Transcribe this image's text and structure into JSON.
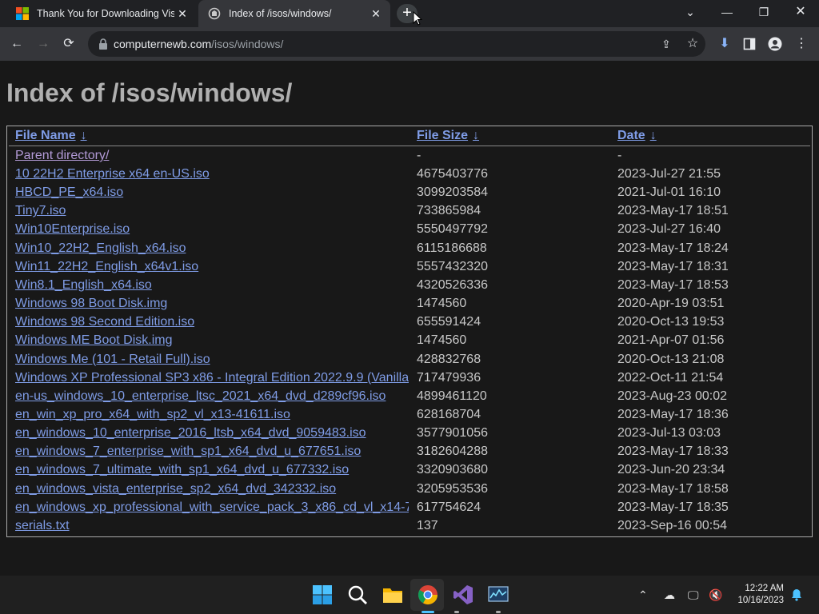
{
  "browser": {
    "tabs": [
      {
        "title": "Thank You for Downloading Visu",
        "active": false
      },
      {
        "title": "Index of /isos/windows/",
        "active": true
      }
    ],
    "new_tab_label": "+",
    "url_domain": "computernewb.com",
    "url_path": "/isos/windows/"
  },
  "page": {
    "heading": "Index of /isos/windows/",
    "columns": {
      "name": "File Name",
      "size": "File Size",
      "date": "Date",
      "sort_arrow": "↓"
    },
    "parent": {
      "name": "Parent directory/",
      "size": "-",
      "date": "-"
    },
    "files": [
      {
        "name": "10 22H2 Enterprise x64 en-US.iso",
        "size": "4675403776",
        "date": "2023-Jul-27 21:55"
      },
      {
        "name": "HBCD_PE_x64.iso",
        "size": "3099203584",
        "date": "2021-Jul-01 16:10"
      },
      {
        "name": "Tiny7.iso",
        "size": "733865984",
        "date": "2023-May-17 18:51"
      },
      {
        "name": "Win10Enterprise.iso",
        "size": "5550497792",
        "date": "2023-Jul-27 16:40"
      },
      {
        "name": "Win10_22H2_English_x64.iso",
        "size": "6115186688",
        "date": "2023-May-17 18:24"
      },
      {
        "name": "Win11_22H2_English_x64v1.iso",
        "size": "5557432320",
        "date": "2023-May-17 18:31"
      },
      {
        "name": "Win8.1_English_x64.iso",
        "size": "4320526336",
        "date": "2023-May-17 18:53"
      },
      {
        "name": "Windows 98 Boot Disk.img",
        "size": "1474560",
        "date": "2020-Apr-19 03:51"
      },
      {
        "name": "Windows 98 Second Edition.iso",
        "size": "655591424",
        "date": "2020-Oct-13 19:53"
      },
      {
        "name": "Windows ME Boot Disk.img",
        "size": "1474560",
        "date": "2021-Apr-07 01:56"
      },
      {
        "name": "Windows Me (101 - Retail Full).iso",
        "size": "428832768",
        "date": "2020-Oct-13 21:08"
      },
      {
        "name": "Windows XP Professional SP3 x86 - Integral Edition 2022.9.9 (Vanilla",
        "size": "717479936",
        "date": "2022-Oct-11 21:54"
      },
      {
        "name": "en-us_windows_10_enterprise_ltsc_2021_x64_dvd_d289cf96.iso",
        "size": "4899461120",
        "date": "2023-Aug-23 00:02"
      },
      {
        "name": "en_win_xp_pro_x64_with_sp2_vl_x13-41611.iso",
        "size": "628168704",
        "date": "2023-May-17 18:36"
      },
      {
        "name": "en_windows_10_enterprise_2016_ltsb_x64_dvd_9059483.iso",
        "size": "3577901056",
        "date": "2023-Jul-13 03:03"
      },
      {
        "name": "en_windows_7_enterprise_with_sp1_x64_dvd_u_677651.iso",
        "size": "3182604288",
        "date": "2023-May-17 18:33"
      },
      {
        "name": "en_windows_7_ultimate_with_sp1_x64_dvd_u_677332.iso",
        "size": "3320903680",
        "date": "2023-Jun-20 23:34"
      },
      {
        "name": "en_windows_vista_enterprise_sp2_x64_dvd_342332.iso",
        "size": "3205953536",
        "date": "2023-May-17 18:58"
      },
      {
        "name": "en_windows_xp_professional_with_service_pack_3_x86_cd_vl_x14-7",
        "size": "617754624",
        "date": "2023-May-17 18:35"
      },
      {
        "name": "serials.txt",
        "size": "137",
        "date": "2023-Sep-16 00:54"
      }
    ]
  },
  "taskbar": {
    "time": "12:22 AM",
    "date": "10/16/2023",
    "icons": [
      "windows-start-icon",
      "search-icon",
      "file-explorer-icon",
      "chrome-icon",
      "visual-studio-icon",
      "resource-monitor-icon"
    ]
  },
  "colors": {
    "link": "#7f9ce6",
    "visited": "#b29ad6",
    "text": "#c8c8c8",
    "heading": "#b0b0b0"
  }
}
